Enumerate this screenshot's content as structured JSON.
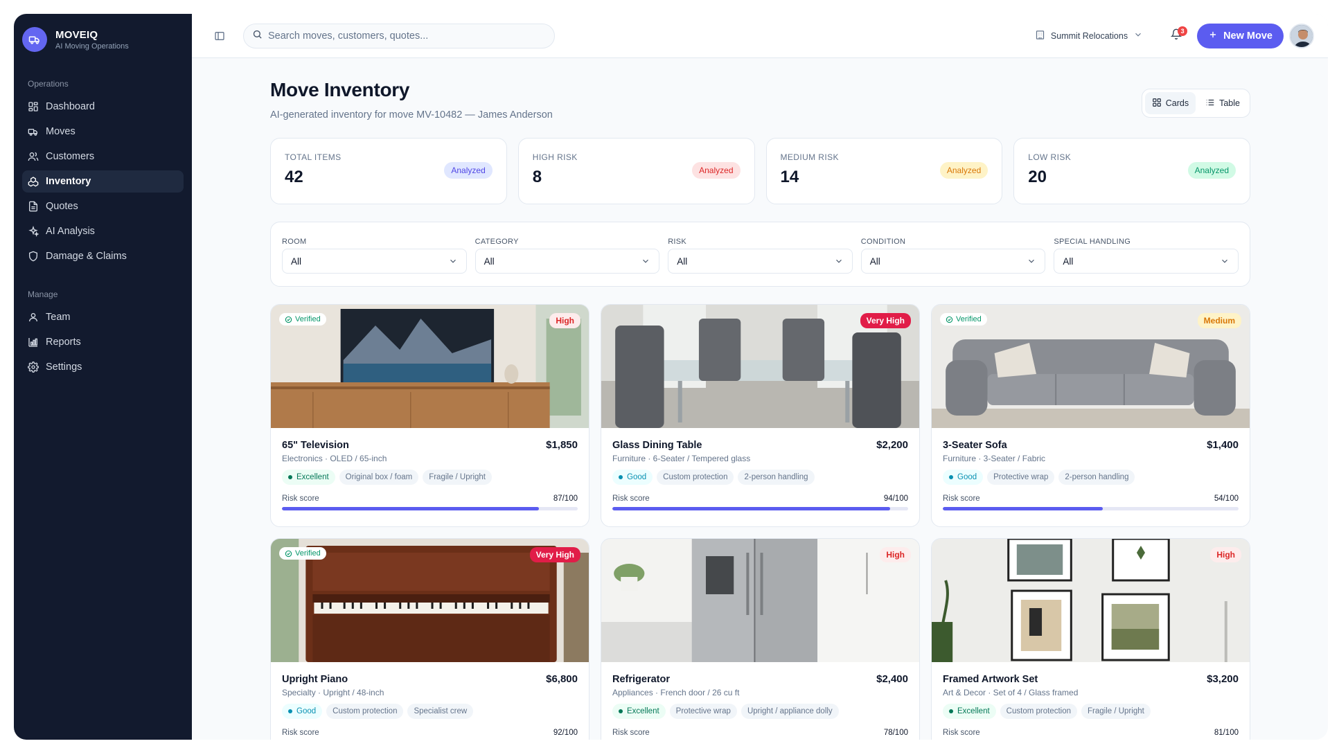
{
  "brand": {
    "name": "MOVEIQ",
    "tagline": "AI Moving Operations"
  },
  "sidebar": {
    "section_ops": "Operations",
    "ops_items": [
      {
        "label": "Dashboard",
        "icon": "dashboard-icon"
      },
      {
        "label": "Moves",
        "icon": "truck-icon"
      },
      {
        "label": "Customers",
        "icon": "users-icon"
      },
      {
        "label": "Inventory",
        "icon": "boxes-icon",
        "active": true
      },
      {
        "label": "Quotes",
        "icon": "document-icon"
      },
      {
        "label": "AI Analysis",
        "icon": "sparkles-icon"
      },
      {
        "label": "Damage & Claims",
        "icon": "shield-icon"
      }
    ],
    "section_manage": "Manage",
    "manage_items": [
      {
        "label": "Team",
        "icon": "user-icon"
      },
      {
        "label": "Reports",
        "icon": "bar-chart-icon"
      },
      {
        "label": "Settings",
        "icon": "gear-icon"
      }
    ]
  },
  "topbar": {
    "search_placeholder": "Search moves, customers, quotes...",
    "org": "Summit Relocations",
    "notifications": "3",
    "new_move": "New Move"
  },
  "page": {
    "title": "Move Inventory",
    "subtitle": "AI-generated inventory for move MV-10482 — James Anderson",
    "view_cards": "Cards",
    "view_table": "Table"
  },
  "stats": [
    {
      "label": "TOTAL ITEMS",
      "value": "42",
      "badge": "Analyzed",
      "tone": "indigo"
    },
    {
      "label": "HIGH RISK",
      "value": "8",
      "badge": "Analyzed",
      "tone": "red"
    },
    {
      "label": "MEDIUM RISK",
      "value": "14",
      "badge": "Analyzed",
      "tone": "amber"
    },
    {
      "label": "LOW RISK",
      "value": "20",
      "badge": "Analyzed",
      "tone": "green"
    }
  ],
  "filters": [
    {
      "label": "ROOM",
      "value": "All"
    },
    {
      "label": "CATEGORY",
      "value": "All"
    },
    {
      "label": "RISK",
      "value": "All"
    },
    {
      "label": "CONDITION",
      "value": "All"
    },
    {
      "label": "SPECIAL HANDLING",
      "value": "All"
    }
  ],
  "risk_score_label": "Risk score",
  "verified_label": "Verified",
  "items": [
    {
      "name": "65\" Television",
      "price": "$1,850",
      "meta": "Electronics · OLED / 65-inch",
      "condition": "Excellent",
      "chips": [
        "Original box / foam",
        "Fragile / Upright"
      ],
      "risk": "High",
      "score": 87,
      "score_text": "87/100",
      "verified": true
    },
    {
      "name": "Glass Dining Table",
      "price": "$2,200",
      "meta": "Furniture · 6-Seater / Tempered glass",
      "condition": "Good",
      "chips": [
        "Custom protection",
        "2-person handling"
      ],
      "risk": "Very High",
      "score": 94,
      "score_text": "94/100",
      "verified": false
    },
    {
      "name": "3-Seater Sofa",
      "price": "$1,400",
      "meta": "Furniture · 3-Seater / Fabric",
      "condition": "Good",
      "chips": [
        "Protective wrap",
        "2-person handling"
      ],
      "risk": "Medium",
      "score": 54,
      "score_text": "54/100",
      "verified": true
    },
    {
      "name": "Upright Piano",
      "price": "$6,800",
      "meta": "Specialty · Upright / 48-inch",
      "condition": "Good",
      "chips": [
        "Custom protection",
        "Specialist crew"
      ],
      "risk": "Very High",
      "score": 92,
      "score_text": "92/100",
      "verified": true
    },
    {
      "name": "Refrigerator",
      "price": "$2,400",
      "meta": "Appliances · French door / 26 cu ft",
      "condition": "Excellent",
      "chips": [
        "Protective wrap",
        "Upright / appliance dolly"
      ],
      "risk": "High",
      "score": 78,
      "score_text": "78/100",
      "verified": false
    },
    {
      "name": "Framed Artwork Set",
      "price": "$3,200",
      "meta": "Art & Decor · Set of 4 / Glass framed",
      "condition": "Excellent",
      "chips": [
        "Custom protection",
        "Fragile / Upright"
      ],
      "risk": "High",
      "score": 81,
      "score_text": "81/100",
      "verified": false
    }
  ],
  "colors": {
    "sidebar": "#121a2e",
    "accent": "#5b5cf0",
    "danger": "#dc2626",
    "warning": "#d97706",
    "success": "#059669"
  }
}
